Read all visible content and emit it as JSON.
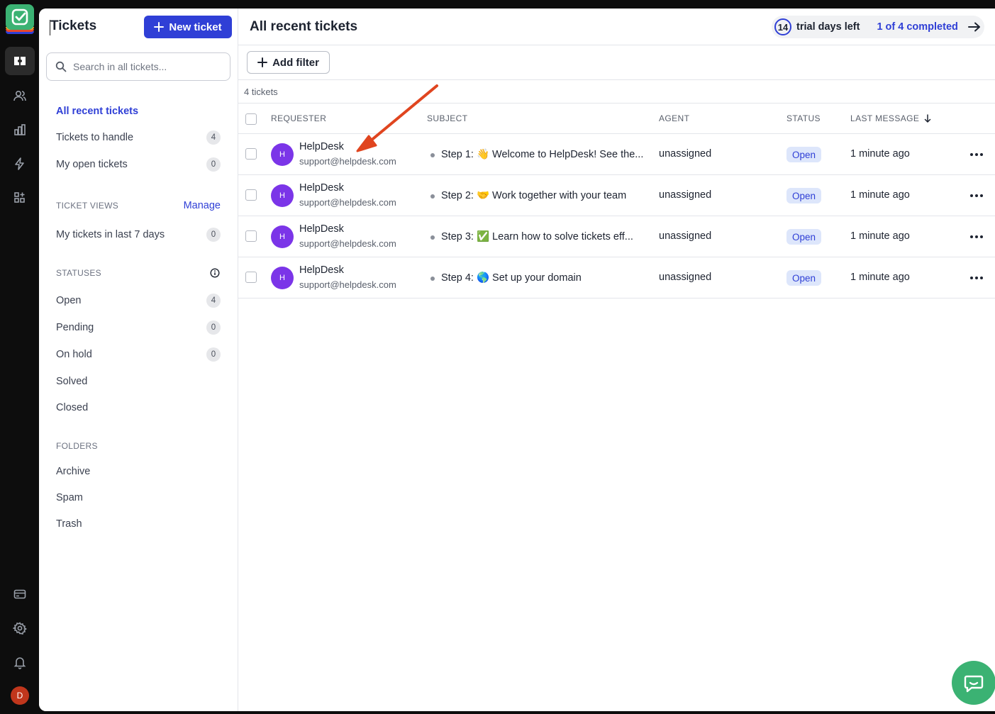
{
  "sidebar": {
    "title": "Tickets",
    "new_ticket_label": "New ticket",
    "search_placeholder": "Search in all tickets...",
    "views": [
      {
        "label": "All recent tickets",
        "count": null
      },
      {
        "label": "Tickets to handle",
        "count": "4"
      },
      {
        "label": "My open tickets",
        "count": "0"
      }
    ],
    "ticket_views_heading": "TICKET VIEWS",
    "manage_label": "Manage",
    "custom_views": [
      {
        "label": "My tickets in last 7 days",
        "count": "0"
      }
    ],
    "statuses_heading": "STATUSES",
    "statuses": [
      {
        "label": "Open",
        "count": "4"
      },
      {
        "label": "Pending",
        "count": "0"
      },
      {
        "label": "On hold",
        "count": "0"
      },
      {
        "label": "Solved",
        "count": null
      },
      {
        "label": "Closed",
        "count": null
      }
    ],
    "folders_heading": "FOLDERS",
    "folders": [
      "Archive",
      "Spam",
      "Trash"
    ]
  },
  "header": {
    "title": "All recent tickets",
    "trial_days": "14",
    "trial_text": "trial days left",
    "progress_text": "1 of 4 completed"
  },
  "toolbar": {
    "add_filter_label": "Add filter",
    "ticket_count": "4 tickets"
  },
  "table": {
    "columns": [
      "REQUESTER",
      "SUBJECT",
      "AGENT",
      "STATUS",
      "LAST MESSAGE"
    ],
    "rows": [
      {
        "initial": "H",
        "name": "HelpDesk",
        "email": "support@helpdesk.com",
        "subject": "Step 1: 👋 Welcome to HelpDesk! See the...",
        "agent": "unassigned",
        "status": "Open",
        "last_message": "1 minute ago"
      },
      {
        "initial": "H",
        "name": "HelpDesk",
        "email": "support@helpdesk.com",
        "subject": "Step 2: 🤝 Work together with your team",
        "agent": "unassigned",
        "status": "Open",
        "last_message": "1 minute ago"
      },
      {
        "initial": "H",
        "name": "HelpDesk",
        "email": "support@helpdesk.com",
        "subject": "Step 3: ✅ Learn how to solve tickets eff...",
        "agent": "unassigned",
        "status": "Open",
        "last_message": "1 minute ago"
      },
      {
        "initial": "H",
        "name": "HelpDesk",
        "email": "support@helpdesk.com",
        "subject": "Step 4: 🌎 Set up your domain",
        "agent": "unassigned",
        "status": "Open",
        "last_message": "1 minute ago"
      }
    ]
  },
  "rail": {
    "icons": [
      "tickets-icon",
      "customers-icon",
      "reports-icon",
      "automation-icon",
      "apps-icon",
      "billing-icon",
      "settings-icon",
      "notifications-icon"
    ],
    "user_initial": "D"
  },
  "colors": {
    "accent": "#2f3fd6",
    "brand_green": "#3bb273",
    "avatar_purple": "#7b35e8",
    "status_open_bg": "#dde6fb",
    "annotation_arrow": "#e0451f"
  }
}
